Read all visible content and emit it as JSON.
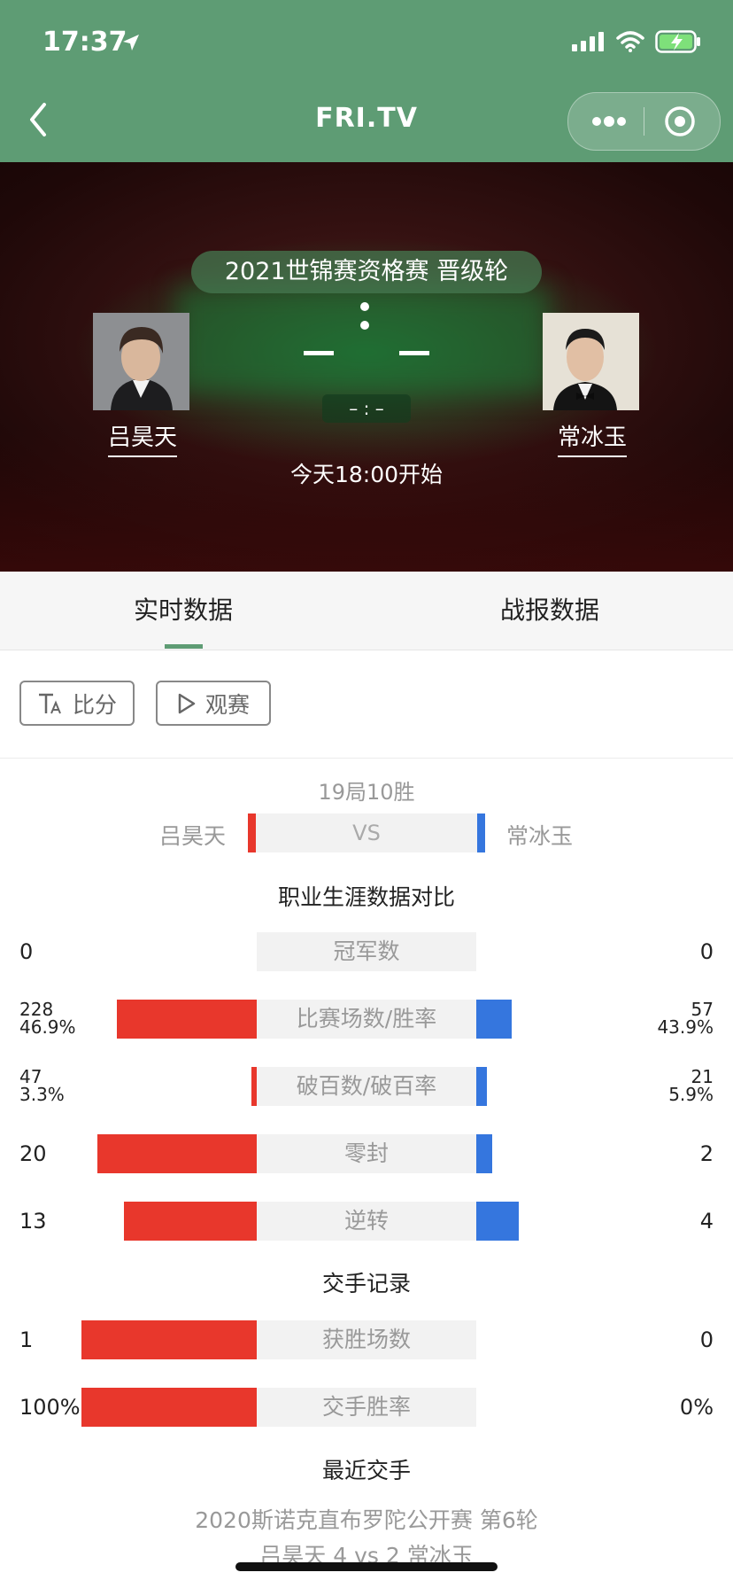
{
  "status": {
    "time": "17:37"
  },
  "nav": {
    "title": "FRI.TV"
  },
  "match": {
    "event": "2021世锦赛资格赛 晋级轮",
    "player_left": "吕昊天",
    "player_right": "常冰玉",
    "frame_score": "– : –",
    "start_time": "今天18:00开始"
  },
  "tabs": [
    {
      "label": "实时数据"
    },
    {
      "label": "战报数据"
    }
  ],
  "actions": {
    "score_label": "比分",
    "watch_label": "观赛"
  },
  "vs": {
    "format": "19局10胜",
    "left": "吕昊天",
    "right": "常冰玉",
    "label": "VS"
  },
  "career": {
    "title": "职业生涯数据对比",
    "rows": [
      {
        "label": "冠军数",
        "left": "0",
        "right": "0",
        "left_ratio": 0,
        "right_ratio": 0
      },
      {
        "label": "比赛场数/胜率",
        "left": "228",
        "left2": "46.9%",
        "right": "57",
        "right2": "43.9%",
        "left_ratio": 0.8,
        "right_ratio": 0.2
      },
      {
        "label": "破百数/破百率",
        "left": "47",
        "left2": "3.3%",
        "right": "21",
        "right2": "5.9%",
        "left_ratio": 0.03,
        "right_ratio": 0.06
      },
      {
        "label": "零封",
        "left": "20",
        "right": "2",
        "left_ratio": 0.91,
        "right_ratio": 0.09
      },
      {
        "label": "逆转",
        "left": "13",
        "right": "4",
        "left_ratio": 0.76,
        "right_ratio": 0.24
      }
    ]
  },
  "h2h": {
    "title": "交手记录",
    "rows": [
      {
        "label": "获胜场数",
        "left": "1",
        "right": "0",
        "left_ratio": 1.0,
        "right_ratio": 0
      },
      {
        "label": "交手胜率",
        "left": "100%",
        "right": "0%",
        "left_ratio": 1.0,
        "right_ratio": 0
      }
    ]
  },
  "recent": {
    "title": "最近交手",
    "event": "2020斯诺克直布罗陀公开赛 第6轮",
    "score": "吕昊天 4 vs 2 常冰玉"
  }
}
